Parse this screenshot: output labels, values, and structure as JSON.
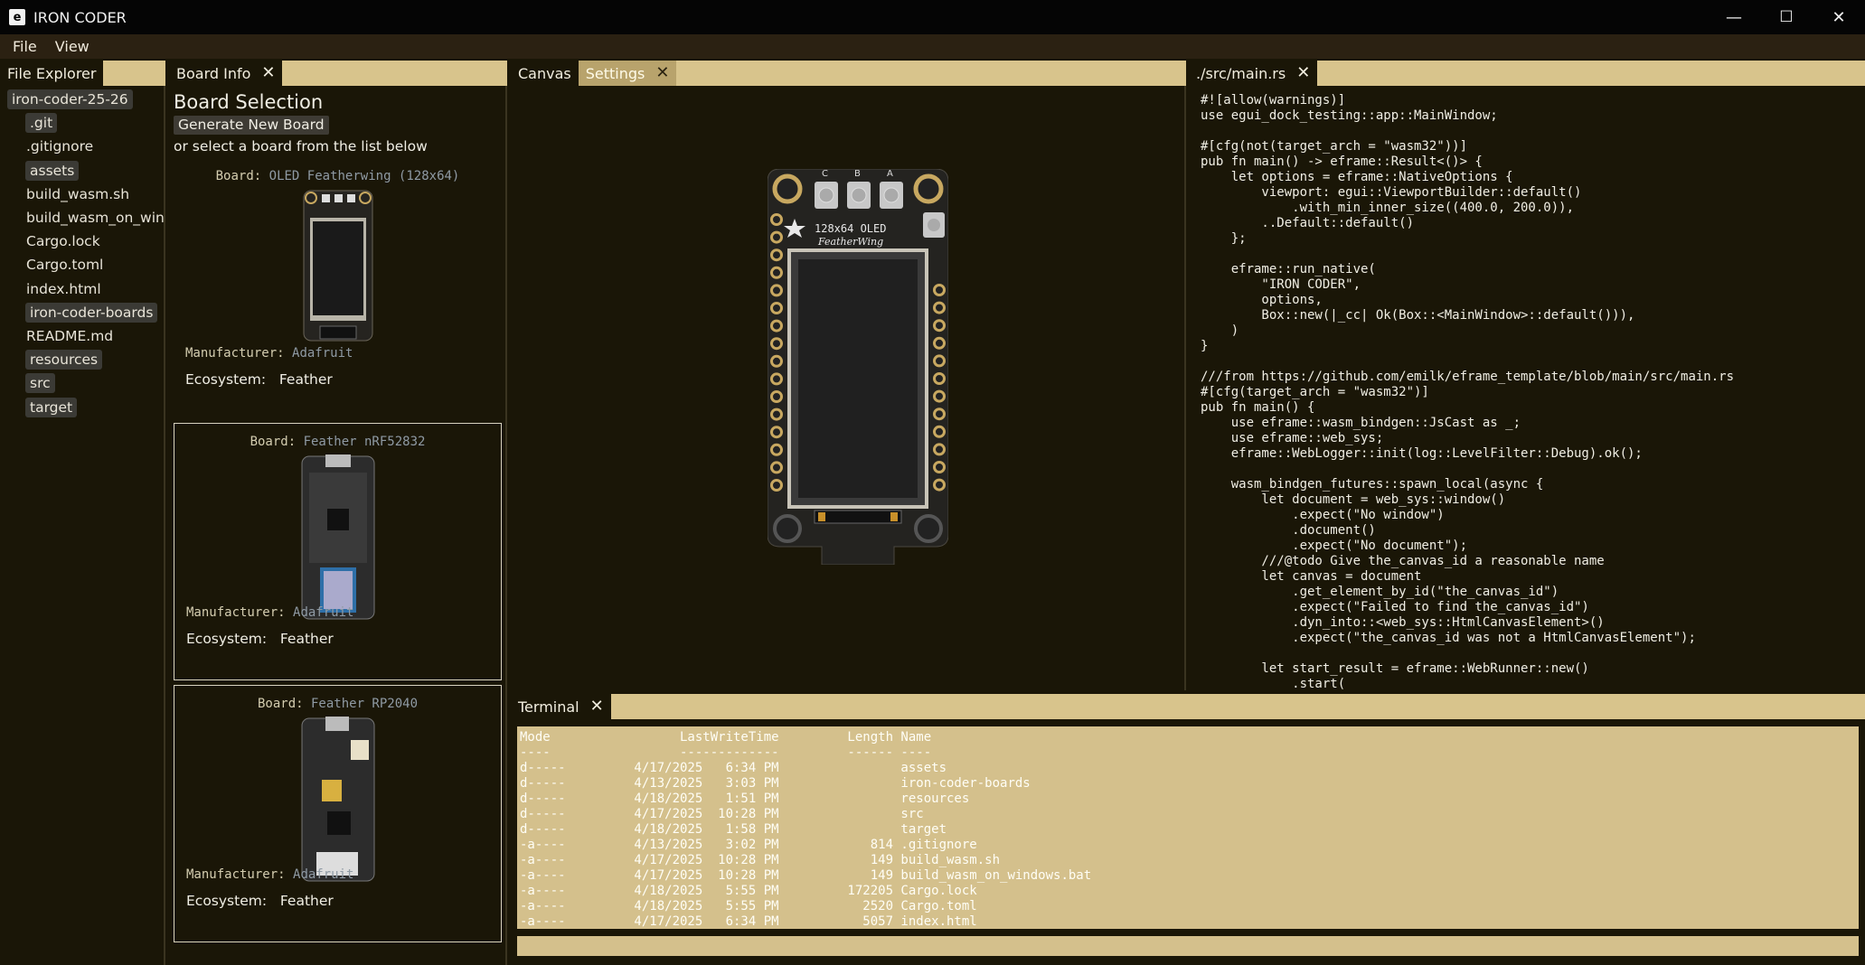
{
  "window": {
    "icon_letter": "e",
    "title": "IRON CODER",
    "minimize": "—",
    "maximize": "☐",
    "close": "✕"
  },
  "menu": [
    "File",
    "View"
  ],
  "file_explorer": {
    "tab": "File Explorer",
    "items": [
      {
        "label": "iron-coder-25-26",
        "dir": true
      },
      {
        "label": ".git",
        "dir": true
      },
      {
        "label": ".gitignore",
        "dir": false
      },
      {
        "label": "assets",
        "dir": true
      },
      {
        "label": "build_wasm.sh",
        "dir": false
      },
      {
        "label": "build_wasm_on_windows.bat",
        "dir": false
      },
      {
        "label": "Cargo.lock",
        "dir": false
      },
      {
        "label": "Cargo.toml",
        "dir": false
      },
      {
        "label": "index.html",
        "dir": false
      },
      {
        "label": "iron-coder-boards",
        "dir": true
      },
      {
        "label": "README.md",
        "dir": false
      },
      {
        "label": "resources",
        "dir": true
      },
      {
        "label": "src",
        "dir": true
      },
      {
        "label": "target",
        "dir": true
      }
    ]
  },
  "board_info": {
    "tab": "Board Info",
    "close": "✕",
    "title": "Board Selection",
    "generate_button": "Generate New Board",
    "subtitle": "or select a board from the list below",
    "board_label": "Board:",
    "manufacturer_label": "Manufacturer:",
    "ecosystem_label": "Ecosystem:",
    "boards": [
      {
        "name": "OLED Featherwing (128x64)",
        "manufacturer": "Adafruit",
        "ecosystem": "Feather"
      },
      {
        "name": "Feather nRF52832",
        "manufacturer": "Adafruit",
        "ecosystem": "Feather"
      },
      {
        "name": "Feather RP2040",
        "manufacturer": "Adafruit",
        "ecosystem": "Feather"
      }
    ]
  },
  "canvas": {
    "tab_canvas": "Canvas",
    "tab_settings": "Settings",
    "close": "✕",
    "board_silk": "128x64 OLED",
    "board_silk2": "FeatherWing",
    "buttons": [
      "C",
      "B",
      "A"
    ]
  },
  "editor": {
    "tab": "./src/main.rs",
    "close": "✕",
    "code": "#![allow(warnings)]\nuse egui_dock_testing::app::MainWindow;\n\n#[cfg(not(target_arch = \"wasm32\"))]\npub fn main() -> eframe::Result<()> {\n    let options = eframe::NativeOptions {\n        viewport: egui::ViewportBuilder::default()\n            .with_min_inner_size((400.0, 200.0)),\n        ..Default::default()\n    };\n\n    eframe::run_native(\n        \"IRON CODER\",\n        options,\n        Box::new(|_cc| Ok(Box::<MainWindow>::default())),\n    )\n}\n\n///from https://github.com/emilk/eframe_template/blob/main/src/main.rs\n#[cfg(target_arch = \"wasm32\")]\npub fn main() {\n    use eframe::wasm_bindgen::JsCast as _;\n    use eframe::web_sys;\n    eframe::WebLogger::init(log::LevelFilter::Debug).ok();\n\n    wasm_bindgen_futures::spawn_local(async {\n        let document = web_sys::window()\n            .expect(\"No window\")\n            .document()\n            .expect(\"No document\");\n        ///@todo Give the_canvas_id a reasonable name\n        let canvas = document\n            .get_element_by_id(\"the_canvas_id\")\n            .expect(\"Failed to find the_canvas_id\")\n            .dyn_into::<web_sys::HtmlCanvasElement>()\n            .expect(\"the_canvas_id was not a HtmlCanvasElement\");\n\n        let start_result = eframe::WebRunner::new()\n            .start("
  },
  "terminal": {
    "tab": "Terminal",
    "close": "✕",
    "output": "Mode                 LastWriteTime         Length Name\n----                 -------------         ------ ----\nd-----         4/17/2025   6:34 PM                assets\nd-----         4/13/2025   3:03 PM                iron-coder-boards\nd-----         4/18/2025   1:51 PM                resources\nd-----         4/17/2025  10:28 PM                src\nd-----         4/18/2025   1:58 PM                target\n-a----         4/13/2025   3:02 PM            814 .gitignore\n-a----         4/17/2025  10:28 PM            149 build_wasm.sh\n-a----         4/17/2025  10:28 PM            149 build_wasm_on_windows.bat\n-a----         4/18/2025   5:55 PM         172205 Cargo.lock\n-a----         4/18/2025   5:55 PM           2520 Cargo.toml\n-a----         4/17/2025   6:34 PM           5057 index.html",
    "input": ""
  }
}
